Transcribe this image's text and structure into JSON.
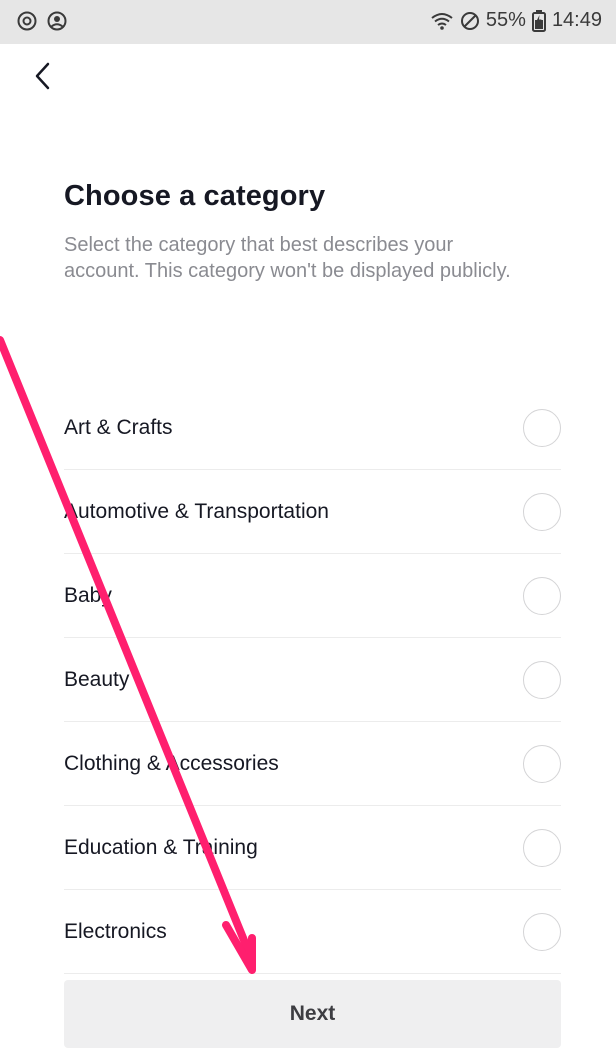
{
  "status_bar": {
    "battery": "55%",
    "time": "14:49",
    "left_icons": [
      "data-saver-icon",
      "account-circle-icon"
    ],
    "right_icons": [
      "wifi-icon",
      "do-not-disturb-icon",
      "battery-icon"
    ]
  },
  "header": {
    "back_icon": "chevron-left-icon"
  },
  "main": {
    "title": "Choose a category",
    "subtitle": "Select the category that best describes your account. This category won't be displayed publicly.",
    "categories": [
      {
        "label": "Art & Crafts",
        "selected": false
      },
      {
        "label": "Automotive & Transportation",
        "selected": false
      },
      {
        "label": "Baby",
        "selected": false
      },
      {
        "label": "Beauty",
        "selected": false
      },
      {
        "label": "Clothing & Accessories",
        "selected": false
      },
      {
        "label": "Education & Training",
        "selected": false
      },
      {
        "label": "Electronics",
        "selected": false
      }
    ],
    "next_label": "Next"
  },
  "annotation": {
    "color": "#ff1f6e",
    "icon": "arrow-annotation"
  }
}
